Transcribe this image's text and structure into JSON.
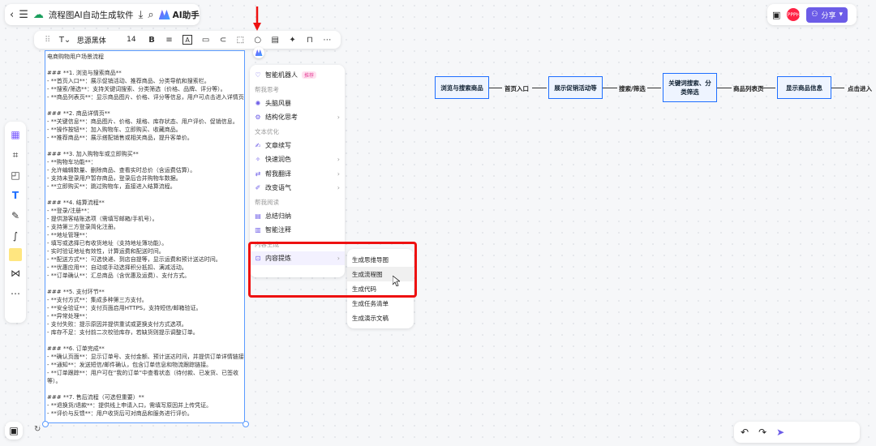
{
  "topbar": {
    "title": "流程图AI自动生成软件",
    "ai_label": "AI助手",
    "share_label": "分享",
    "avatar_text": "PPPH"
  },
  "format_toolbar": {
    "font": "思源黑体",
    "size": "14"
  },
  "document": {
    "lines": [
      "电商购物用户场景流程",
      "",
      "### **1. 浏览与搜索商品**",
      "- **首页入口**：展示促销活动、推荐商品、分类导航和搜索栏。",
      "- **搜索/筛选**：支持关键词搜索、分类筛选（价格、品牌、评分等）。",
      "- **商品列表页**：显示商品图片、价格、评分等信息，用户可点击进入详情页。",
      "",
      "### **2. 商品详情页**",
      "- **关键信息**：商品图片、价格、规格、库存状态、用户评价、促销信息。",
      "- **操作按钮**：加入购物车、立即购买、收藏商品。",
      "- **推荐商品**：展示搭配销售或相关商品，提升客单价。",
      "",
      "### **3. 加入购物车或立即购买**",
      "- **购物车功能**：",
      "- 允许编辑数量、删除商品、查看实时总价（含运费估算）。",
      "- 支持未登录用户暂存商品，登录后合并购物车数据。",
      "- **立即购买**：跳过购物车，直接进入结算流程。",
      "",
      "### **4. 结算流程**",
      "- **登录/注册**：",
      "- 提供游客结账选项（需填写邮箱/手机号）。",
      "- 支持第三方登录简化注册。",
      "- **地址管理**：",
      "- 填写或选择已有收货地址（支持地址簿功能）。",
      "- 实时验证地址有效性，计算运费和配送时间。",
      "- **配送方式**：可选快递、到店自提等，显示运费和预计送达时间。",
      "- **优惠应用**：自动或手动选择积分抵扣、满减活动。",
      "- **订单确认**：汇总商品（含优惠及运费）、支付方式。",
      "",
      "### **5. 支付环节**",
      "- **支付方式**：集成多种第三方支付。",
      "- **安全验证**：支付页面启用HTTPS，支持短信/邮箱验证。",
      "- **异常处理**：",
      "- 支付失败：提示原因并提供重试或更换支付方式选项。",
      "- 库存不足：支付前二次校验库存，若缺货则提示调整订单。",
      "",
      "### **6. 订单完成**",
      "- **确认页面**：显示订单号、支付金额、预计送达时间，并提供订单详情链接。",
      "- **通知**：发送短信/邮件确认，包含订单信息和物流跟踪链接。",
      "- **订单跟踪**：用户可在“我的订单”中查看状态（待付款、已发货、已签收",
      "等）。",
      "",
      "### **7. 售后流程（可选但重要）**",
      "- **退换货/退款**：提供线上申请入口，需填写原因并上传凭证。",
      "- **评价与反馈**：用户收货后可对商品和服务进行评价。"
    ]
  },
  "menu": {
    "items": [
      {
        "type": "item",
        "label": "智能机器人",
        "badge": "推荐",
        "chevron": ""
      },
      {
        "type": "section",
        "label": "帮我思考"
      },
      {
        "type": "item",
        "label": "头脑风暴",
        "badge": "",
        "chevron": ""
      },
      {
        "type": "item",
        "label": "结构化思考",
        "badge": "",
        "chevron": "›"
      },
      {
        "type": "section",
        "label": "文本优化"
      },
      {
        "type": "item",
        "label": "文章续写",
        "badge": "",
        "chevron": ""
      },
      {
        "type": "item",
        "label": "快速润色",
        "badge": "",
        "chevron": "›"
      },
      {
        "type": "item",
        "label": "帮我翻译",
        "badge": "",
        "chevron": "›"
      },
      {
        "type": "item",
        "label": "改变语气",
        "badge": "",
        "chevron": "›"
      },
      {
        "type": "section",
        "label": "帮我阅读"
      },
      {
        "type": "item",
        "label": "总结归纳",
        "badge": "",
        "chevron": ""
      },
      {
        "type": "item",
        "label": "智能注释",
        "badge": "",
        "chevron": ""
      },
      {
        "type": "section",
        "label": "内容生成"
      },
      {
        "type": "item",
        "label": "内容提炼",
        "badge": "",
        "chevron": "›",
        "hot": true
      }
    ]
  },
  "submenu": {
    "items": [
      "生成思维导图",
      "生成流程图",
      "生成代码",
      "生成任务清单",
      "生成演示文稿"
    ]
  },
  "flowchart": {
    "nodes": [
      "浏览与搜索商品",
      "展示促销活动等",
      "关键词搜索、分类筛选",
      "显示商品信息"
    ],
    "edges": [
      "首页入口",
      "搜索/筛选",
      "商品列表页",
      "点击进入"
    ]
  },
  "colors": {
    "accent": "#6c5ce7",
    "node_border": "#1f6fff",
    "highlight": "#e11111"
  }
}
